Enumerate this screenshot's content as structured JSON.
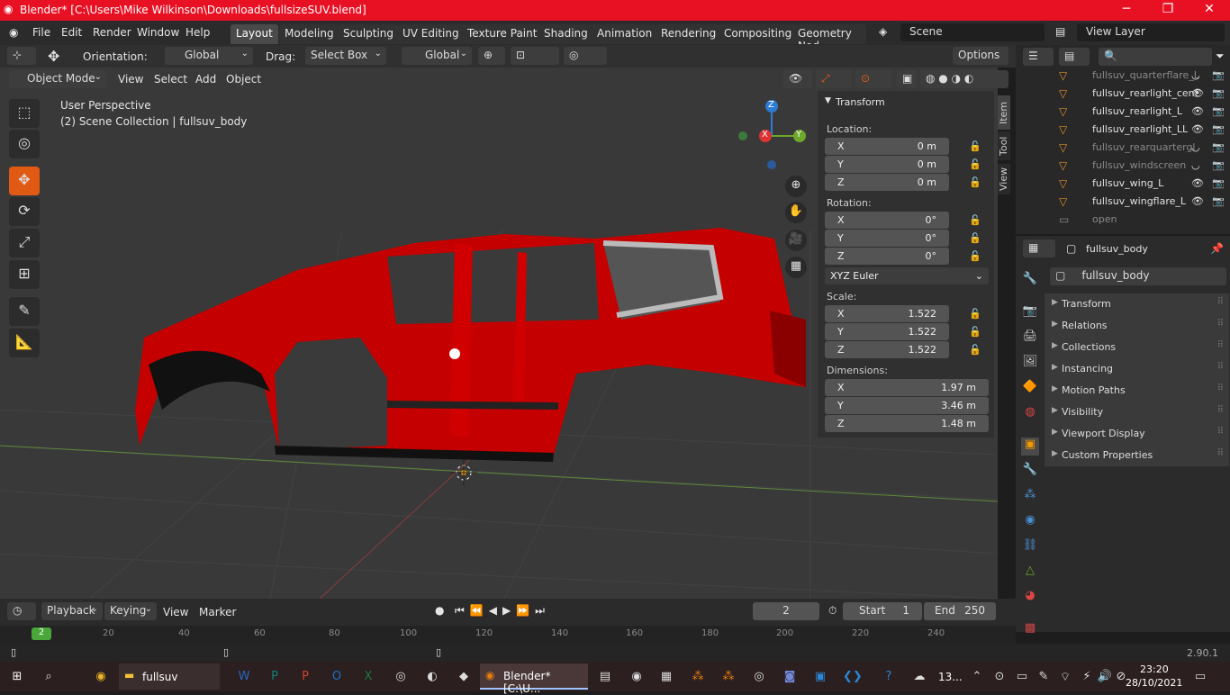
{
  "window": {
    "title": "Blender* [C:\\Users\\Mike Wilkinson\\Downloads\\fullsizeSUV.blend]",
    "minimize_icon": "minimize-icon",
    "maximize_icon": "maximize-icon",
    "close_icon": "close-icon"
  },
  "menu": [
    "File",
    "Edit",
    "Render",
    "Window",
    "Help"
  ],
  "workspaces": [
    "Layout",
    "Modeling",
    "Sculpting",
    "UV Editing",
    "Texture Paint",
    "Shading",
    "Animation",
    "Rendering",
    "Compositing",
    "Geometry Nod"
  ],
  "active_workspace": "Layout",
  "scene": "Scene",
  "view_layer": "View Layer",
  "toolhdr": {
    "orientation_label": "Orientation:",
    "orientation_value": "Global",
    "drag_label": "Drag:",
    "drag_value": "Select Box",
    "transform_value": "Global",
    "options": "Options"
  },
  "vphdr": {
    "mode": "Object Mode",
    "items": [
      "View",
      "Select",
      "Add",
      "Object"
    ]
  },
  "viewport": {
    "perspective": "User Perspective",
    "collection": "(2) Scene Collection | fullsuv_body",
    "car_color": "#cc0000",
    "bg_color": "#393939"
  },
  "gizmo": {
    "z": "Z",
    "x": "X",
    "y": "Y"
  },
  "npanel": {
    "header": "Transform",
    "location_label": "Location:",
    "location": [
      {
        "axis": "X",
        "value": "0 m"
      },
      {
        "axis": "Y",
        "value": "0 m"
      },
      {
        "axis": "Z",
        "value": "0 m"
      }
    ],
    "rotation_label": "Rotation:",
    "rotation": [
      {
        "axis": "X",
        "value": "0°"
      },
      {
        "axis": "Y",
        "value": "0°"
      },
      {
        "axis": "Z",
        "value": "0°"
      }
    ],
    "rotation_mode": "XYZ Euler",
    "scale_label": "Scale:",
    "scale": [
      {
        "axis": "X",
        "value": "1.522"
      },
      {
        "axis": "Y",
        "value": "1.522"
      },
      {
        "axis": "Z",
        "value": "1.522"
      }
    ],
    "dimensions_label": "Dimensions:",
    "dimensions": [
      {
        "axis": "X",
        "value": "1.97 m"
      },
      {
        "axis": "Y",
        "value": "3.46 m"
      },
      {
        "axis": "Z",
        "value": "1.48 m"
      }
    ]
  },
  "side_tabs": [
    "Item",
    "Tool",
    "View"
  ],
  "outliner": {
    "rows": [
      {
        "name": "fullsuv_quarterflare_L",
        "dim": true
      },
      {
        "name": "fullsuv_rearlight_cent",
        "dim": false
      },
      {
        "name": "fullsuv_rearlight_L",
        "dim": false
      },
      {
        "name": "fullsuv_rearlight_LL",
        "dim": false
      },
      {
        "name": "fullsuv_rearquartergl",
        "dim": true
      },
      {
        "name": "fullsuv_windscreen",
        "dim": true
      },
      {
        "name": "fullsuv_wing_L",
        "dim": false
      },
      {
        "name": "fullsuv_wingflare_L",
        "dim": false
      },
      {
        "name": "open",
        "dim": true
      }
    ]
  },
  "props": {
    "header_object": "fullsuv_body",
    "object_name": "fullsuv_body",
    "panels": [
      "Transform",
      "Relations",
      "Collections",
      "Instancing",
      "Motion Paths",
      "Visibility",
      "Viewport Display",
      "Custom Properties"
    ]
  },
  "timeline": {
    "menus": [
      "Playback",
      "Keying",
      "View",
      "Marker"
    ],
    "current_frame": "2",
    "start_label": "Start",
    "start": "1",
    "end_label": "End",
    "end": "250",
    "ruler": [
      "2",
      "20",
      "40",
      "60",
      "80",
      "100",
      "120",
      "140",
      "160",
      "180",
      "200",
      "220",
      "240"
    ]
  },
  "status": {
    "version": "2.90.1"
  },
  "taskbar": {
    "fullsuv": "fullsuv",
    "blender": "Blender* [C:\\U...",
    "temp": "13...",
    "time": "23:20",
    "date": "28/10/2021"
  }
}
